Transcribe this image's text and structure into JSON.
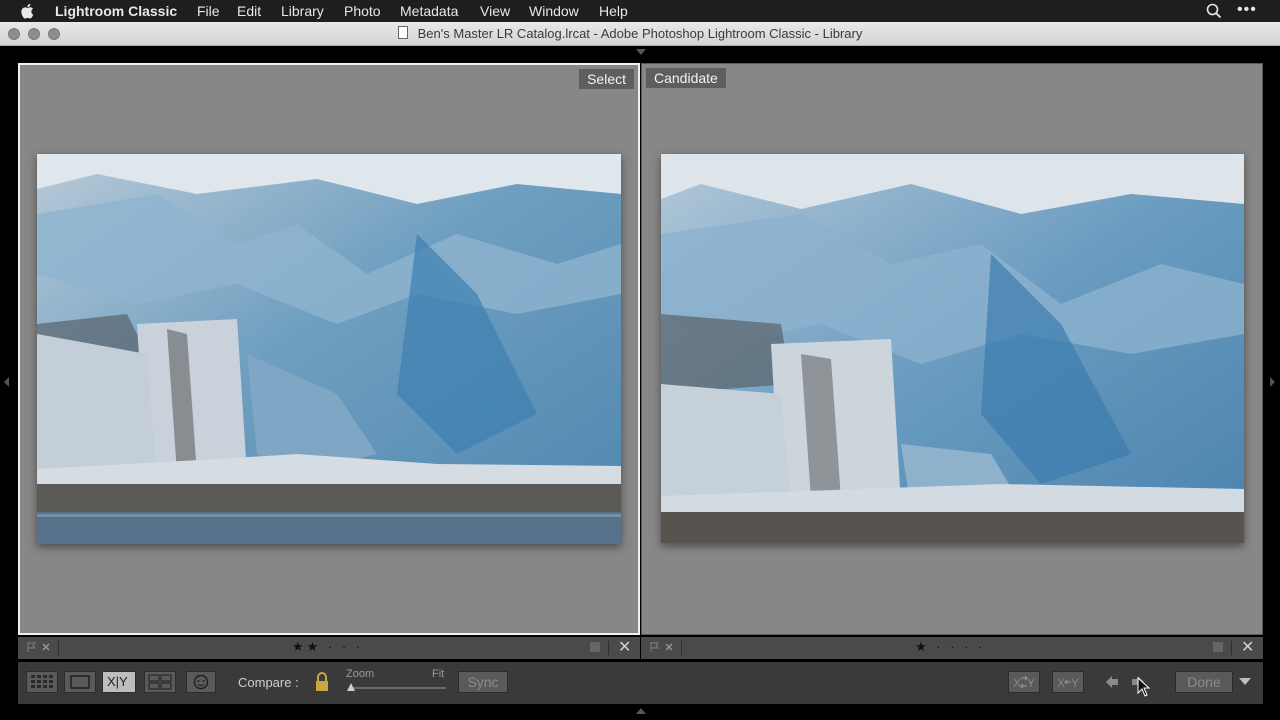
{
  "menubar": {
    "app_name": "Lightroom Classic",
    "items": [
      "File",
      "Edit",
      "Library",
      "Photo",
      "Metadata",
      "View",
      "Window",
      "Help"
    ]
  },
  "window": {
    "title": "Ben's Master LR Catalog.lrcat - Adobe Photoshop Lightroom Classic - Library"
  },
  "compare": {
    "select_label": "Select",
    "candidate_label": "Candidate",
    "select_rating": "★★ · · ·",
    "candidate_rating": "★ · · · ·"
  },
  "toolbar": {
    "compare_label": "Compare :",
    "zoom_label": "Zoom",
    "fit_label": "Fit",
    "sync_label": "Sync",
    "done_label": "Done",
    "xy_label": "X|Y"
  },
  "colors": {
    "panel_bg": "#878787",
    "toolbar_bg": "#3a3a3a",
    "select_border": "#f0f0f0"
  },
  "icons": {
    "apple": "apple-icon",
    "search": "search-icon",
    "more": "more-icon",
    "grid": "grid-view-icon",
    "loupe": "loupe-view-icon",
    "compare": "compare-view-icon",
    "survey": "survey-view-icon",
    "people": "people-view-icon",
    "lock": "lock-icon",
    "swap": "swap-icon",
    "make_select": "make-select-icon",
    "prev": "previous-arrow-icon",
    "next": "next-arrow-icon",
    "menu": "toolbar-menu-icon"
  }
}
